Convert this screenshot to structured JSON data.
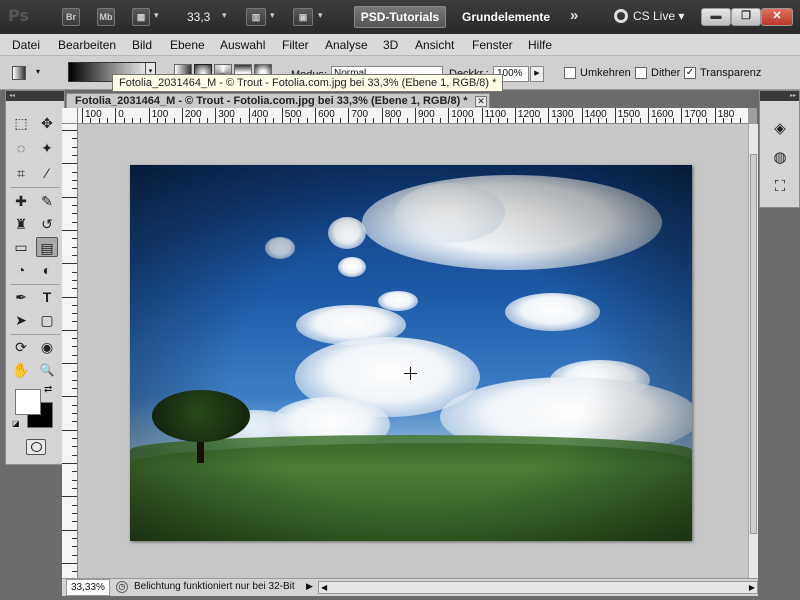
{
  "app": {
    "logo": "Ps",
    "buttons": {
      "bridge": "Br",
      "minibridge": "Mb"
    },
    "zoom": "33,3",
    "workspace_active": "PSD-Tutorials",
    "workspace_inactive": "Grundelemente",
    "more": "»",
    "cs_live": "CS Live",
    "dropdown_arrow": "▾"
  },
  "menu": [
    "Datei",
    "Bearbeiten",
    "Bild",
    "Ebene",
    "Auswahl",
    "Filter",
    "Analyse",
    "3D",
    "Ansicht",
    "Fenster",
    "Hilfe"
  ],
  "options": {
    "tooltip": "Fotolia_2031464_M - © Trout - Fotolia.com.jpg bei 33,3% (Ebene 1, RGB/8) *",
    "modus_label": "Modus:",
    "modus_value": "Normal",
    "deckkr_label": "Deckkr.:",
    "deckkr_value": "100%",
    "umkehren": "Umkehren",
    "dither": "Dither",
    "transparenz": "Transparenz",
    "check_mark": "✓"
  },
  "document": {
    "tab_title": "Fotolia_2031464_M - © Trout - Fotolia.com.jpg bei 33,3% (Ebene 1, RGB/8) *",
    "close": "✕",
    "ruler_h_labels": [
      "100",
      "0",
      "100",
      "200",
      "300",
      "400",
      "500",
      "600",
      "700",
      "800",
      "900",
      "1000",
      "1100",
      "1200",
      "1300",
      "1400",
      "1500",
      "1600",
      "1700",
      "180"
    ]
  },
  "status": {
    "zoom": "33,33%",
    "text": "Belichtung funktioniert nur bei 32-Bit",
    "arrow": "▶"
  },
  "icons": {
    "marquee": "⬚",
    "move": "✥",
    "lasso": "◌",
    "magic_wand": "✦",
    "crop": "⌗",
    "eyedropper": "⁄",
    "healing": "✚",
    "brush": "✎",
    "stamp": "♜",
    "history_brush": "↺",
    "eraser": "▭",
    "gradient": "▤",
    "blur": "◔",
    "dodge": "◐",
    "pen": "✒",
    "type": "T",
    "path_select": "➤",
    "shape": "▢",
    "3d_rotate": "⟳",
    "3d_camera": "◉",
    "hand": "✋",
    "zoom": "🔍",
    "layers": "◈",
    "channels": "◍",
    "paths": "⛶"
  }
}
